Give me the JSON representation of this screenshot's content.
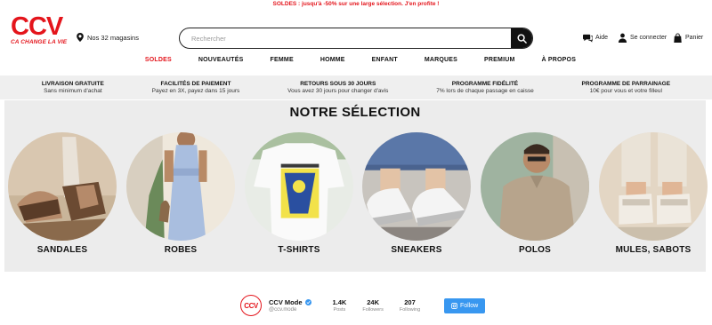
{
  "promo_banner": "SOLDES : jusqu'à -50% sur une large sélection. J'en profite !",
  "brand": {
    "logo_text": "CCV",
    "tagline": "CA CHANGE LA VIE",
    "accent": "#e4151c"
  },
  "stores": {
    "label": "Nos 32 magasins",
    "icon": "map-pin-icon"
  },
  "search": {
    "placeholder": "Rechercher",
    "value": "",
    "button_icon": "search-icon"
  },
  "utilities": [
    {
      "label": "Aide",
      "icon": "chat-help-icon"
    },
    {
      "label": "Se connecter",
      "icon": "user-icon"
    },
    {
      "label": "Panier",
      "icon": "shopping-bag-icon"
    }
  ],
  "nav": [
    "SOLDES",
    "NOUVEAUTÉS",
    "FEMME",
    "HOMME",
    "ENFANT",
    "MARQUES",
    "PREMIUM",
    "À PROPOS"
  ],
  "benefits": [
    {
      "title": "LIVRAISON GRATUITE",
      "subtitle": "Sans minimum d'achat"
    },
    {
      "title": "FACILITÉS DE PAIEMENT",
      "subtitle": "Payez en 3X, payez dans 15 jours"
    },
    {
      "title": "RETOURS SOUS 30 JOURS",
      "subtitle": "Vous avez 30 jours pour changer d'avis"
    },
    {
      "title": "PROGRAMME FIDÉLITÉ",
      "subtitle": "7% lors de chaque passage en caisse"
    },
    {
      "title": "PROGRAMME DE PARRAINAGE",
      "subtitle": "10€ pour vous et votre filleul"
    }
  ],
  "selection": {
    "title": "NOTRE SÉLECTION",
    "categories": [
      {
        "label": "SANDALES"
      },
      {
        "label": "ROBES"
      },
      {
        "label": "T-SHIRTS"
      },
      {
        "label": "SNEAKERS"
      },
      {
        "label": "POLOS"
      },
      {
        "label": "MULES, SABOTS"
      }
    ]
  },
  "social": {
    "avatar_text": "CCV",
    "name": "CCV Mode",
    "handle": "@ccv.mode",
    "stats": [
      {
        "value": "1.4K",
        "label": "Posts"
      },
      {
        "value": "24K",
        "label": "Followers"
      },
      {
        "value": "207",
        "label": "Following"
      }
    ],
    "follow_label": "Follow",
    "follow_color": "#3897f0"
  }
}
